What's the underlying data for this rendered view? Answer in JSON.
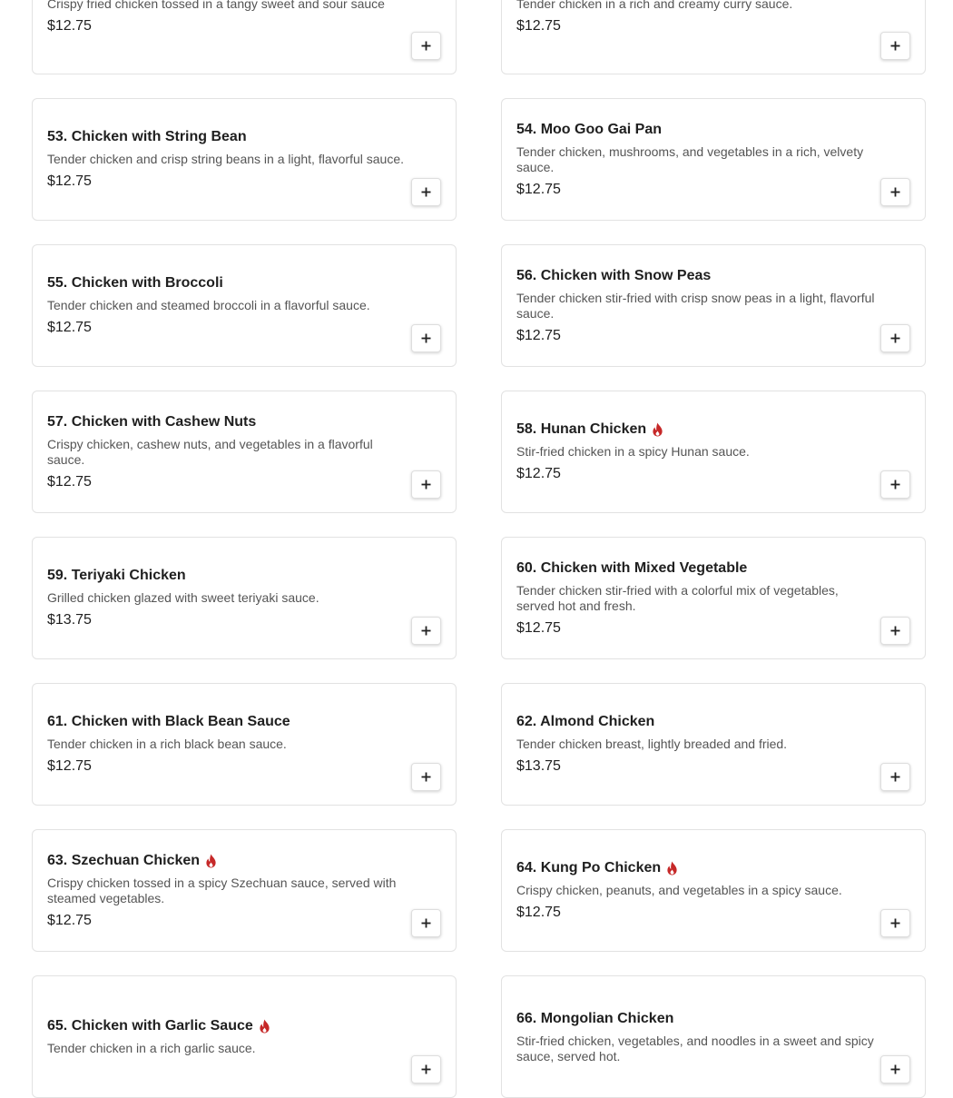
{
  "accent_colors": {
    "spicy": "#c62828",
    "price": "#1f1f1f",
    "description": "#555555"
  },
  "add_button_icon": "plus-icon",
  "spicy_icon": "flame-icon",
  "items": [
    {
      "title": "",
      "description": "Crispy fried chicken tossed in a tangy sweet and sour sauce",
      "price": "$12.75",
      "spicy": false
    },
    {
      "title": "",
      "description": "Tender chicken in a rich and creamy curry sauce.",
      "price": "$12.75",
      "spicy": false
    },
    {
      "title": "53. Chicken with String Bean",
      "description": "Tender chicken and crisp string beans in a light, flavorful sauce.",
      "price": "$12.75",
      "spicy": false
    },
    {
      "title": "54. Moo Goo Gai Pan",
      "description": "Tender chicken, mushrooms, and vegetables in a rich, velvety sauce.",
      "price": "$12.75",
      "spicy": false
    },
    {
      "title": "55. Chicken with Broccoli",
      "description": "Tender chicken and steamed broccoli in a flavorful sauce.",
      "price": "$12.75",
      "spicy": false
    },
    {
      "title": "56. Chicken with Snow Peas",
      "description": "Tender chicken stir-fried with crisp snow peas in a light, flavorful sauce.",
      "price": "$12.75",
      "spicy": false
    },
    {
      "title": "57. Chicken with Cashew Nuts",
      "description": "Crispy chicken, cashew nuts, and vegetables in a flavorful sauce.",
      "price": "$12.75",
      "spicy": false
    },
    {
      "title": "58. Hunan Chicken",
      "description": "Stir-fried chicken in a spicy Hunan sauce.",
      "price": "$12.75",
      "spicy": true
    },
    {
      "title": "59. Teriyaki Chicken",
      "description": "Grilled chicken glazed with sweet teriyaki sauce.",
      "price": "$13.75",
      "spicy": false
    },
    {
      "title": "60. Chicken with Mixed Vegetable",
      "description": "Tender chicken stir-fried with a colorful mix of vegetables, served hot and fresh.",
      "price": "$12.75",
      "spicy": false
    },
    {
      "title": "61. Chicken with Black Bean Sauce",
      "description": "Tender chicken in a rich black bean sauce.",
      "price": "$12.75",
      "spicy": false
    },
    {
      "title": "62. Almond Chicken",
      "description": "Tender chicken breast, lightly breaded and fried.",
      "price": "$13.75",
      "spicy": false
    },
    {
      "title": "63. Szechuan Chicken",
      "description": "Crispy chicken tossed in a spicy Szechuan sauce, served with steamed vegetables.",
      "price": "$12.75",
      "spicy": true
    },
    {
      "title": "64. Kung Po Chicken",
      "description": "Crispy chicken, peanuts, and vegetables in a spicy sauce.",
      "price": "$12.75",
      "spicy": true
    },
    {
      "title": "65. Chicken with Garlic Sauce",
      "description": "Tender chicken in a rich garlic sauce.",
      "price": "",
      "spicy": true
    },
    {
      "title": "66. Mongolian Chicken",
      "description": "Stir-fried chicken, vegetables, and noodles in a sweet and spicy sauce, served hot.",
      "price": "",
      "spicy": false
    }
  ]
}
